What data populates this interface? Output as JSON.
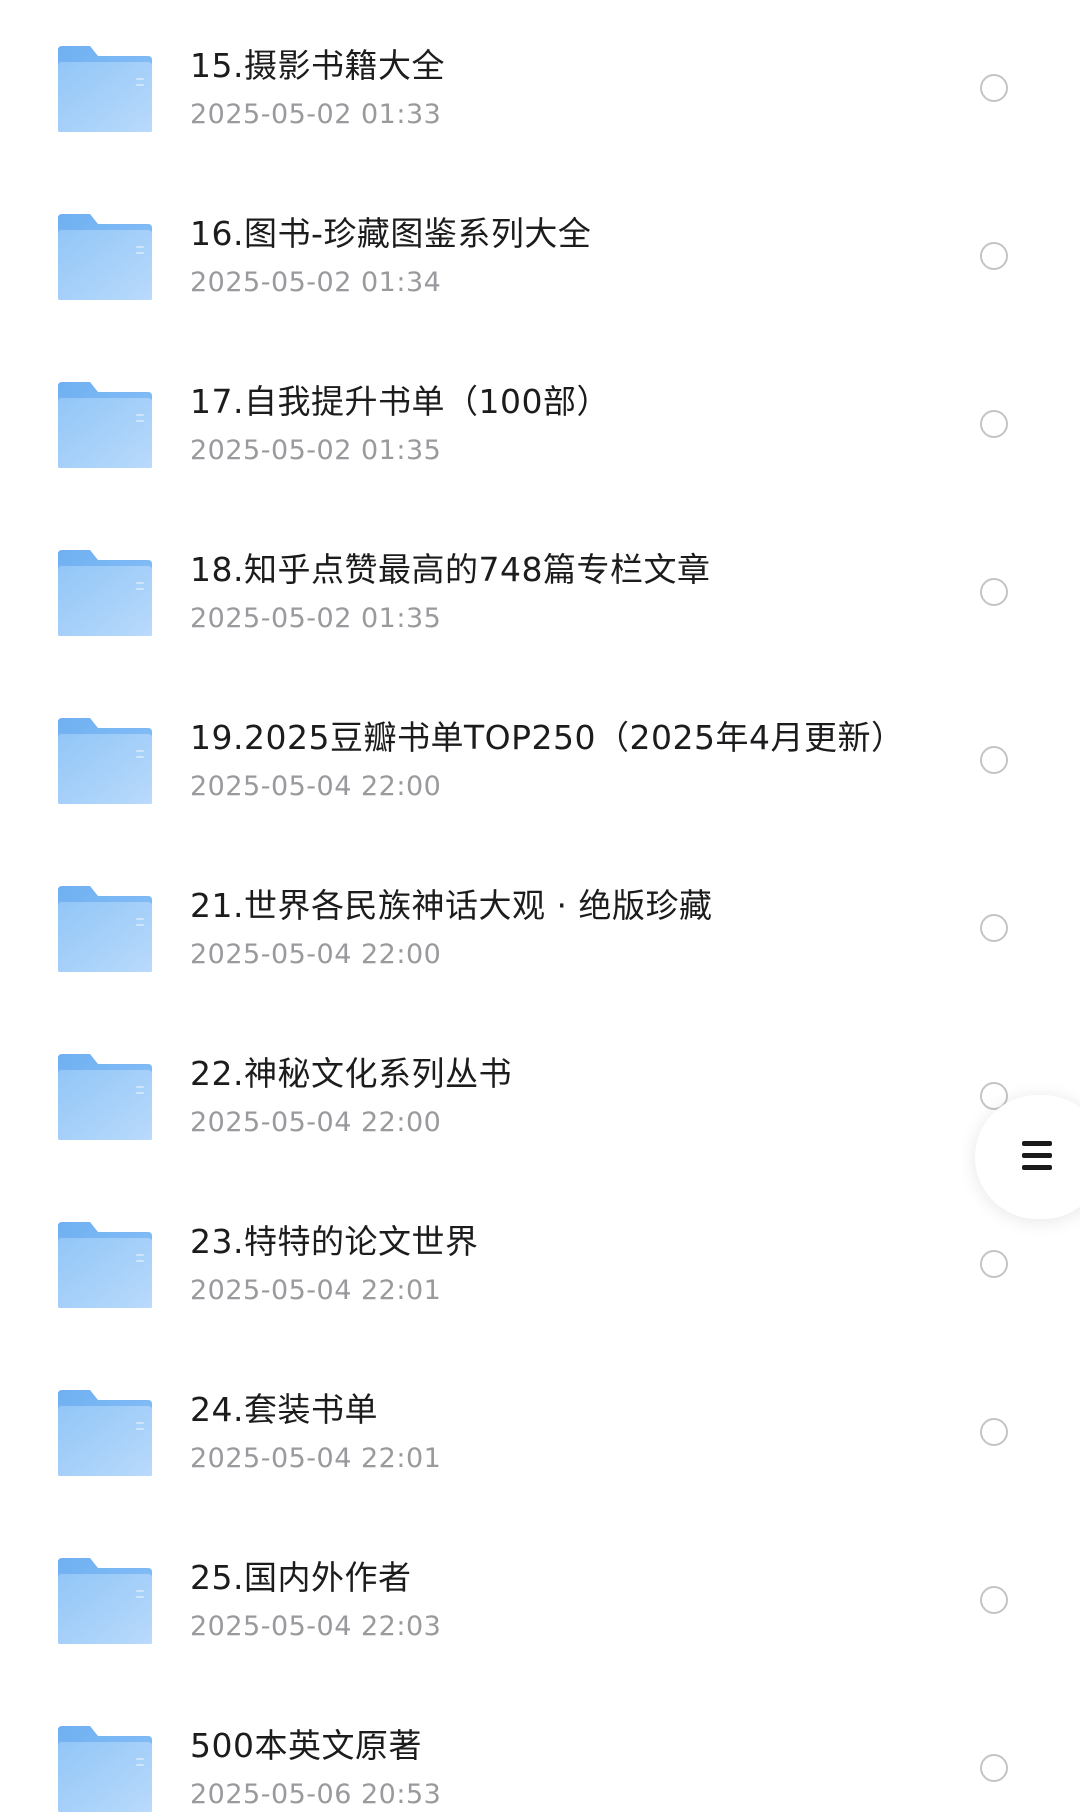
{
  "colors": {
    "folder_light": "#b9dafb",
    "folder_dark": "#6fb0f2",
    "title": "#1c1c1e",
    "date": "#9a9a9e",
    "radio_border": "#c4c4c8"
  },
  "items": [
    {
      "title": "15.摄影书籍大全",
      "date": "2025-05-02 01:33",
      "icon": "folder-icon"
    },
    {
      "title": "16.图书-珍藏图鉴系列大全",
      "date": "2025-05-02 01:34",
      "icon": "folder-icon"
    },
    {
      "title": "17.自我提升书单（100部）",
      "date": "2025-05-02 01:35",
      "icon": "folder-icon"
    },
    {
      "title": "18.知乎点赞最高的748篇专栏文章",
      "date": "2025-05-02 01:35",
      "icon": "folder-icon"
    },
    {
      "title": "19.2025豆瓣书单TOP250（2025年4月更新）",
      "date": "2025-05-04 22:00",
      "icon": "folder-icon"
    },
    {
      "title": "21.世界各民族神话大观 · 绝版珍藏",
      "date": "2025-05-04 22:00",
      "icon": "folder-icon"
    },
    {
      "title": "22.神秘文化系列丛书",
      "date": "2025-05-04 22:00",
      "icon": "folder-icon"
    },
    {
      "title": "23.特特的论文世界",
      "date": "2025-05-04 22:01",
      "icon": "folder-icon"
    },
    {
      "title": "24.套装书单",
      "date": "2025-05-04 22:01",
      "icon": "folder-icon"
    },
    {
      "title": "25.国内外作者",
      "date": "2025-05-04 22:03",
      "icon": "folder-icon"
    },
    {
      "title": "500本英文原著",
      "date": "2025-05-06 20:53",
      "icon": "folder-icon"
    }
  ],
  "fab": {
    "icon": "menu-icon"
  }
}
